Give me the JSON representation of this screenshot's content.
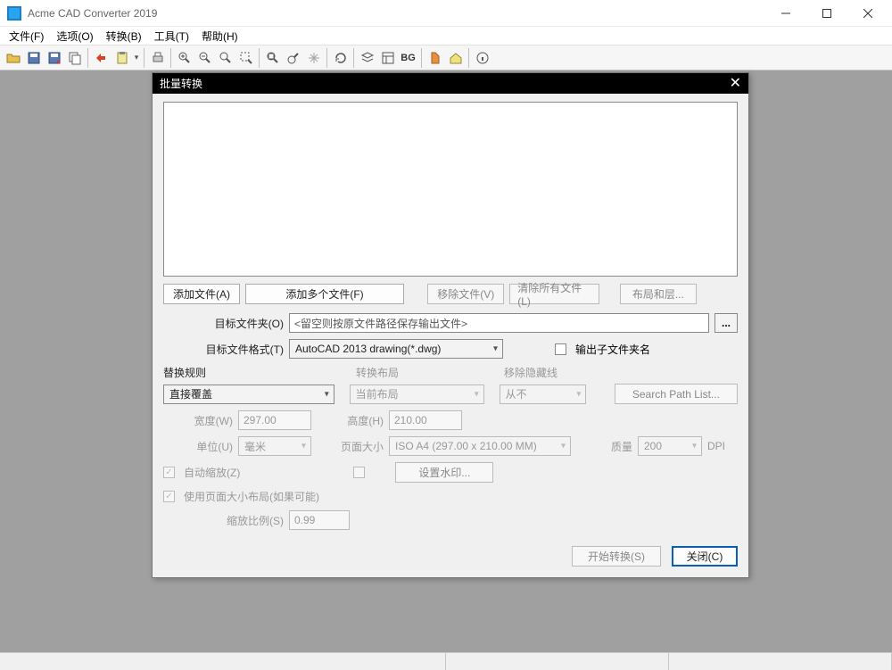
{
  "titlebar": {
    "title": "Acme CAD Converter 2019"
  },
  "menu": {
    "file": "文件(F)",
    "options": "选项(O)",
    "convert": "转换(B)",
    "tools": "工具(T)",
    "help": "帮助(H)"
  },
  "dialog": {
    "title": "批量转换",
    "buttons": {
      "add_file": "添加文件(A)",
      "add_files": "添加多个文件(F)",
      "remove": "移除文件(V)",
      "clear": "清除所有文件(L)",
      "layers": "布局和层...",
      "start": "开始转换(S)",
      "close": "关闭(C)",
      "browse": "...",
      "search_path": "Search Path List...",
      "watermark": "设置水印..."
    },
    "labels": {
      "target_folder": "目标文件夹(O)",
      "target_format": "目标文件格式(T)",
      "output_subfolder": "输出子文件夹名",
      "replace_rule": "替换规则",
      "convert_layout": "转换布局",
      "remove_hidden": "移除隐藏线",
      "width": "宽度(W)",
      "height": "高度(H)",
      "unit": "单位(U)",
      "page_size": "页面大小",
      "quality": "质量",
      "dpi": "DPI",
      "auto_zoom": "自动缩放(Z)",
      "use_page_layout": "使用页面大小布局(如果可能)",
      "zoom_ratio": "缩放比例(S)"
    },
    "values": {
      "target_folder_placeholder": "<留空则按原文件路径保存输出文件>",
      "target_format": "AutoCAD 2013 drawing(*.dwg)",
      "replace_rule": "直接覆盖",
      "convert_layout": "当前布局",
      "remove_hidden": "从不",
      "width": "297.00",
      "height": "210.00",
      "unit": "毫米",
      "page_size": "ISO A4 (297.00 x 210.00 MM)",
      "quality": "200",
      "zoom_ratio": "0.99"
    }
  }
}
